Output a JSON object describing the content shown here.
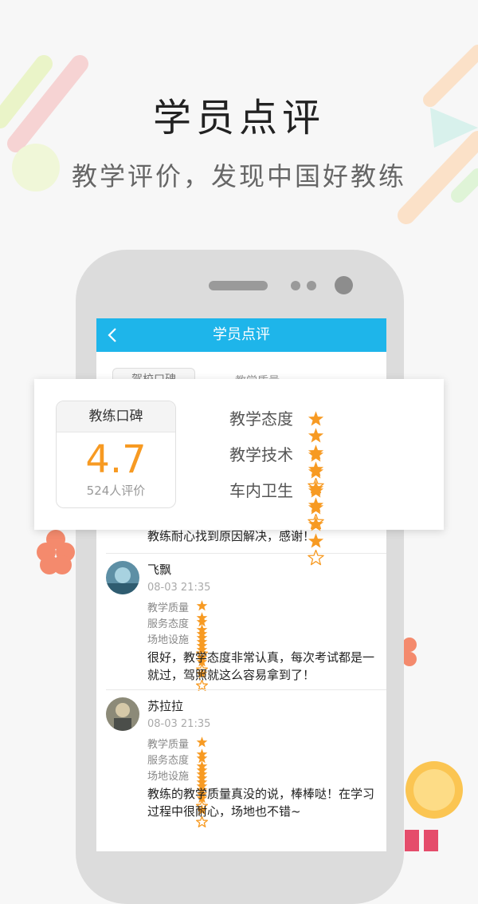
{
  "promo": {
    "title": "学员点评",
    "subtitle": "教学评价，发现中国好教练"
  },
  "screen": {
    "nav_title": "学员点评",
    "back_icon": "chevron-left-icon",
    "behind_tab_label": "驾校口碑",
    "behind_row_label": "教学质量",
    "partial_review_text": "教练耐心找到原因解决，感谢！"
  },
  "summary_card": {
    "header": "教练口碑",
    "score": "4.7",
    "count_text": "524人评价",
    "criteria": [
      {
        "label": "教学态度",
        "rating": 4
      },
      {
        "label": "教学技术",
        "rating": 4
      },
      {
        "label": "车内卫生",
        "rating": 4
      }
    ]
  },
  "reviews": [
    {
      "name": "飞飘",
      "time": "08-03 21:35",
      "ratings": [
        {
          "label": "教学质量",
          "rating": 4
        },
        {
          "label": "服务态度",
          "rating": 4
        },
        {
          "label": "场地设施",
          "rating": 4
        }
      ],
      "text": "很好，教学态度非常认真，每次考试都是一就过，驾照就这么容易拿到了！"
    },
    {
      "name": "苏拉拉",
      "time": "08-03 21:35",
      "ratings": [
        {
          "label": "教学质量",
          "rating": 5
        },
        {
          "label": "服务态度",
          "rating": 4
        },
        {
          "label": "场地设施",
          "rating": 4
        }
      ],
      "text": "教练的教学质量真没的说，棒棒哒！在学习过程中很耐心，场地也不错~"
    }
  ],
  "colors": {
    "accent": "#1eb5ea",
    "star": "#f79a22",
    "score": "#f79a22"
  }
}
